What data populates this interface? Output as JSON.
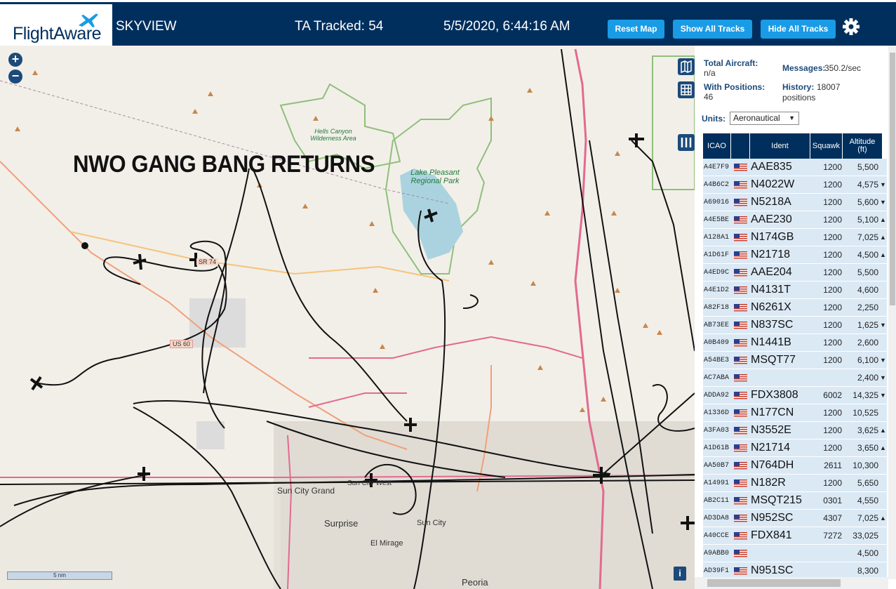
{
  "header": {
    "logo_text": "FlightAware",
    "app_title": "SKYVIEW",
    "ta_tracked": "TA Tracked: 54",
    "datetime": "5/5/2020, 6:44:16 AM",
    "reset_map": "Reset Map",
    "show_all_tracks": "Show All Tracks",
    "hide_all_tracks": "Hide All Tracks",
    "settings_icon": "gear-icon"
  },
  "map": {
    "overlay_text": "NWO GANG BANG RETURNS",
    "zoom_in": "+",
    "zoom_out": "−",
    "scale_label": "5 nm",
    "info_label": "i",
    "labels": {
      "hells_canyon": "Hells Canyon Wilderness Area",
      "lake_pleasant": "Lake Pleasant Regional Park",
      "sun_city_grand": "Sun City Grand",
      "sun_city_west": "Sun City West",
      "surprise": "Surprise",
      "sun_city": "Sun City",
      "el_mirage": "El Mirage",
      "peoria": "Peoria",
      "us60": "US 60",
      "sr74": "SR 74"
    },
    "colors": {
      "track": "#111111",
      "highway": "#e36a8f",
      "park": "#8fbf7a",
      "water": "#aad3df"
    }
  },
  "panel": {
    "total_aircraft_label": "Total Aircraft:",
    "total_aircraft_value": "n/a",
    "messages_label": "Messages:",
    "messages_value": "350.2/sec",
    "with_positions_label": "With Positions:",
    "with_positions_value": "46",
    "history_label": "History:",
    "history_value": "18007 positions",
    "units_label": "Units:",
    "units_value": "Aeronautical",
    "columns": [
      "ICAO",
      "",
      "Ident",
      "Squawk",
      "Altitude (ft)"
    ],
    "rows": [
      {
        "icao": "A4E7F9",
        "ident": "AAE835",
        "squawk": "1200",
        "alt": "5,500",
        "arrow": ""
      },
      {
        "icao": "A4B6C2",
        "ident": "N4022W",
        "squawk": "1200",
        "alt": "4,575",
        "arrow": "▼"
      },
      {
        "icao": "A69016",
        "ident": "N5218A",
        "squawk": "1200",
        "alt": "5,600",
        "arrow": "▼"
      },
      {
        "icao": "A4E5BE",
        "ident": "AAE230",
        "squawk": "1200",
        "alt": "5,100",
        "arrow": "▲"
      },
      {
        "icao": "A128A1",
        "ident": "N174GB",
        "squawk": "1200",
        "alt": "7,025",
        "arrow": "▲"
      },
      {
        "icao": "A1D61F",
        "ident": "N21718",
        "squawk": "1200",
        "alt": "4,500",
        "arrow": "▲"
      },
      {
        "icao": "A4ED9C",
        "ident": "AAE204",
        "squawk": "1200",
        "alt": "5,500",
        "arrow": ""
      },
      {
        "icao": "A4E1D2",
        "ident": "N4131T",
        "squawk": "1200",
        "alt": "4,600",
        "arrow": ""
      },
      {
        "icao": "A82F18",
        "ident": "N6261X",
        "squawk": "1200",
        "alt": "2,250",
        "arrow": ""
      },
      {
        "icao": "AB73EE",
        "ident": "N837SC",
        "squawk": "1200",
        "alt": "1,625",
        "arrow": "▼"
      },
      {
        "icao": "A0B409",
        "ident": "N1441B",
        "squawk": "1200",
        "alt": "2,600",
        "arrow": ""
      },
      {
        "icao": "A54BE3",
        "ident": "MSQT77",
        "squawk": "1200",
        "alt": "6,100",
        "arrow": "▼"
      },
      {
        "icao": "AC7ABA",
        "ident": "",
        "squawk": "",
        "alt": "2,400",
        "arrow": "▼"
      },
      {
        "icao": "ADDA92",
        "ident": "FDX3808",
        "squawk": "6002",
        "alt": "14,325",
        "arrow": "▼"
      },
      {
        "icao": "A1336D",
        "ident": "N177CN",
        "squawk": "1200",
        "alt": "10,525",
        "arrow": ""
      },
      {
        "icao": "A3FA03",
        "ident": "N3552E",
        "squawk": "1200",
        "alt": "3,625",
        "arrow": "▲"
      },
      {
        "icao": "A1D61B",
        "ident": "N21714",
        "squawk": "1200",
        "alt": "3,650",
        "arrow": "▲"
      },
      {
        "icao": "AA50B7",
        "ident": "N764DH",
        "squawk": "2611",
        "alt": "10,300",
        "arrow": ""
      },
      {
        "icao": "A14991",
        "ident": "N182R",
        "squawk": "1200",
        "alt": "5,650",
        "arrow": ""
      },
      {
        "icao": "AB2C11",
        "ident": "MSQT215",
        "squawk": "0301",
        "alt": "4,550",
        "arrow": ""
      },
      {
        "icao": "AD3DA8",
        "ident": "N952SC",
        "squawk": "4307",
        "alt": "7,025",
        "arrow": "▲"
      },
      {
        "icao": "A40CCE",
        "ident": "FDX841",
        "squawk": "7272",
        "alt": "33,025",
        "arrow": ""
      },
      {
        "icao": "A9ABB0",
        "ident": "",
        "squawk": "",
        "alt": "4,500",
        "arrow": ""
      },
      {
        "icao": "AD39F1",
        "ident": "N951SC",
        "squawk": "",
        "alt": "8,300",
        "arrow": ""
      }
    ]
  }
}
